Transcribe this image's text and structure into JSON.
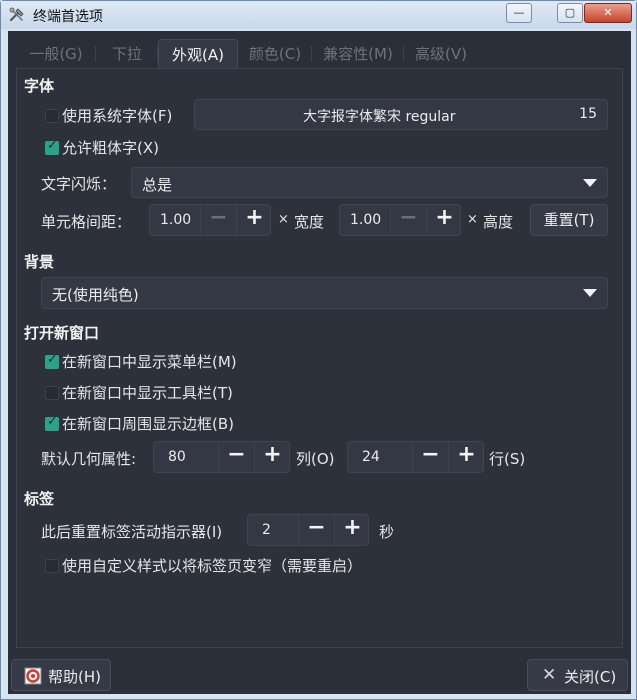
{
  "window": {
    "title": "终端首选项"
  },
  "tabs": [
    {
      "label": "一般(G)"
    },
    {
      "label": "下拉"
    },
    {
      "label": "外观(A)"
    },
    {
      "label": "颜色(C)"
    },
    {
      "label": "兼容性(M)"
    },
    {
      "label": "高级(V)"
    }
  ],
  "font": {
    "section": "字体",
    "use_system_font_label": "使用系统字体(F)",
    "use_system_font_checked": false,
    "font_name": "大字报字体繁宋 regular",
    "font_size": "15",
    "allow_bold_label": "允许粗体字(X)",
    "allow_bold_checked": true,
    "blink_label": "文字闪烁：",
    "blink_value": "总是",
    "spacing_label": "单元格间距：",
    "width_value": "1.00",
    "times": "×",
    "width_label": "宽度",
    "height_value": "1.00",
    "height_label": "高度",
    "reset_label": "重置(T)"
  },
  "background": {
    "section": "背景",
    "value": "无(使用纯色)"
  },
  "new_window": {
    "section": "打开新窗口",
    "show_menubar_label": "在新窗口中显示菜单栏(M)",
    "show_menubar_checked": true,
    "show_toolbar_label": "在新窗口中显示工具栏(T)",
    "show_toolbar_checked": false,
    "show_border_label": "在新窗口周围显示边框(B)",
    "show_border_checked": true,
    "geometry_label": "默认几何属性:",
    "columns_value": "80",
    "columns_label": "列(O)",
    "rows_value": "24",
    "rows_label": "行(S)"
  },
  "tabs_section": {
    "section": "标签",
    "reset_indicator_label": "此后重置标签活动指示器(I)",
    "reset_indicator_value": "2",
    "seconds_label": "秒",
    "custom_style_label": "使用自定义样式以将标签页变窄（需要重启）",
    "custom_style_checked": false
  },
  "footer": {
    "help_label": "帮助(H)",
    "close_label": "关闭(C)"
  },
  "icons": {
    "minus": "−",
    "plus": "+",
    "close_x": "✕",
    "minimize": "—",
    "maximize": "▢"
  },
  "colors": {
    "accent": "#2aa38a",
    "background": "#2b2f39"
  }
}
